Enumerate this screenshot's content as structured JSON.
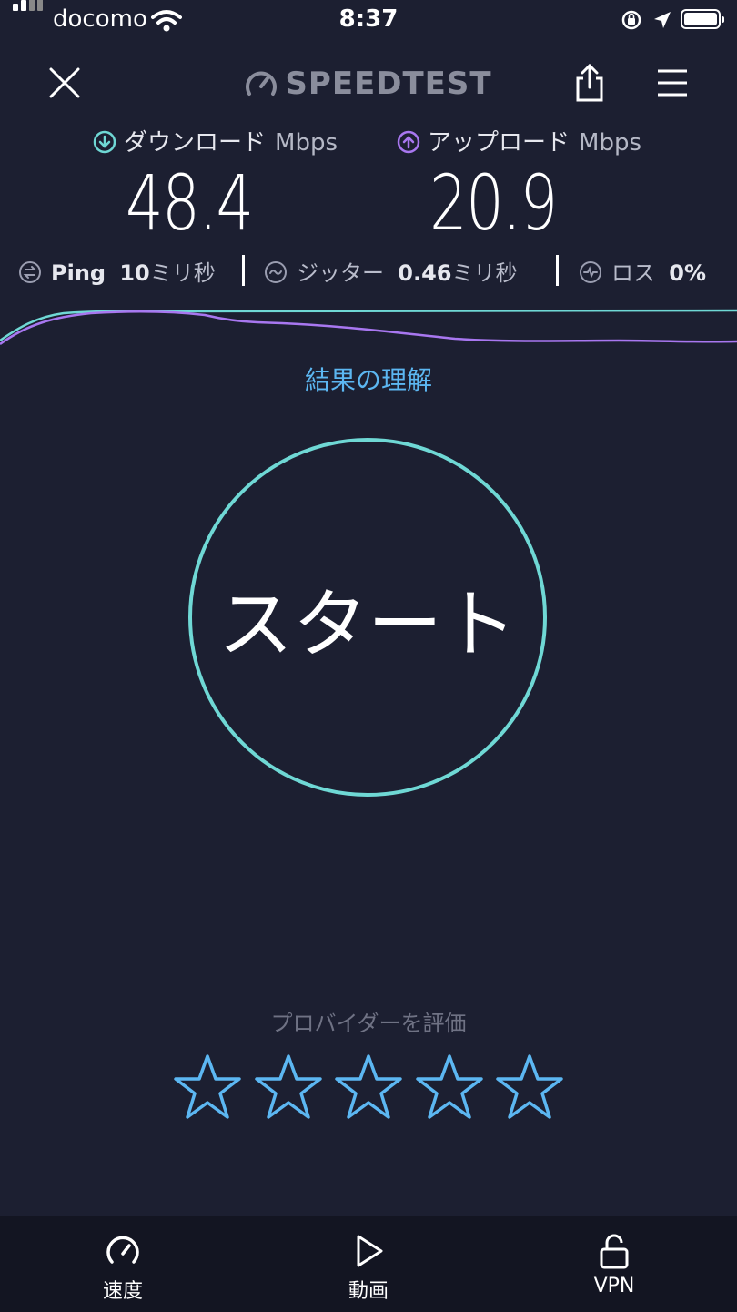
{
  "status_bar": {
    "carrier": "docomo",
    "time": "8:37"
  },
  "header": {
    "logo_text": "SPEEDTEST"
  },
  "download": {
    "label": "ダウンロード",
    "unit": "Mbps",
    "value": "48.4",
    "color": "#6fd8d5"
  },
  "upload": {
    "label": "アップロード",
    "unit": "Mbps",
    "value": "20.9",
    "color": "#a877f0"
  },
  "metrics": {
    "ping": {
      "label": "Ping",
      "value": "10",
      "unit": "ミリ秒"
    },
    "jitter": {
      "label": "ジッター",
      "value": "0.46",
      "unit": "ミリ秒"
    },
    "loss": {
      "label": "ロス",
      "value": "0%"
    }
  },
  "understand_link": "結果の理解",
  "start_button": "スタート",
  "rating": {
    "label": "プロバイダーを評価",
    "stars": 5,
    "star_color": "#5cb7f2"
  },
  "tabs": [
    {
      "label": "速度",
      "icon": "speedometer-icon"
    },
    {
      "label": "動画",
      "icon": "play-icon"
    },
    {
      "label": "VPN",
      "icon": "lock-icon"
    }
  ]
}
